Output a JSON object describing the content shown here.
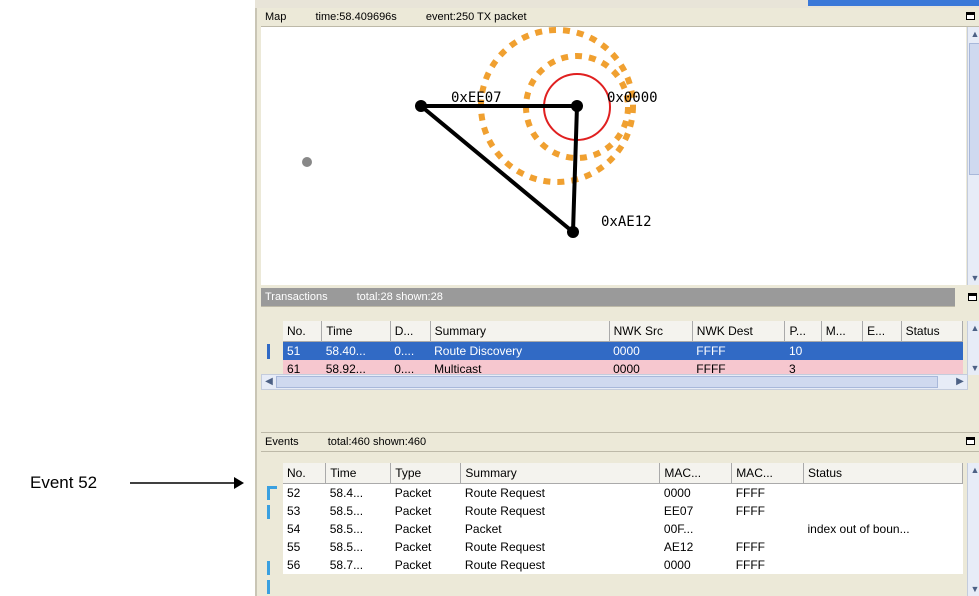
{
  "map": {
    "title": "Map",
    "time": "time:58.409696s",
    "event": "event:250 TX packet",
    "nodes": [
      {
        "label": "0xEE07"
      },
      {
        "label": "0x0000"
      },
      {
        "label": "0xAE12"
      }
    ]
  },
  "transactions": {
    "title": "Transactions",
    "stats": "total:28 shown:28",
    "columns": [
      "No.",
      "Time",
      "D...",
      "Summary",
      "NWK Src",
      "NWK Dest",
      "P...",
      "M...",
      "E...",
      "Status"
    ],
    "rows": [
      [
        "51",
        "58.40...",
        "0....",
        "Route Discovery",
        "0000",
        "FFFF",
        "10",
        "",
        "",
        ""
      ],
      [
        "61",
        "58.92...",
        "0....",
        "Multicast",
        "0000",
        "FFFF",
        "3",
        "",
        "",
        ""
      ]
    ]
  },
  "events": {
    "title": "Events",
    "stats": "total:460 shown:460",
    "columns": [
      "No.",
      "Time",
      "Type",
      "Summary",
      "MAC...",
      "MAC...",
      "Status"
    ],
    "rows": [
      [
        "52",
        "58.4...",
        "Packet",
        "Route Request",
        "0000",
        "FFFF",
        ""
      ],
      [
        "53",
        "58.5...",
        "Packet",
        "Route Request",
        "EE07",
        "FFFF",
        ""
      ],
      [
        "54",
        "58.5...",
        "Packet",
        "Packet",
        "00F...",
        "",
        "index out of boun..."
      ],
      [
        "55",
        "58.5...",
        "Packet",
        "Route Request",
        "AE12",
        "FFFF",
        ""
      ],
      [
        "56",
        "58.7...",
        "Packet",
        "Route Request",
        "0000",
        "FFFF",
        ""
      ]
    ]
  },
  "annotation": {
    "label": "Event 52"
  },
  "colors": {
    "selection": "#316ac5",
    "pink": "#f6c7cf",
    "range_orange": "#f0a030",
    "tx_red": "#e02020"
  }
}
